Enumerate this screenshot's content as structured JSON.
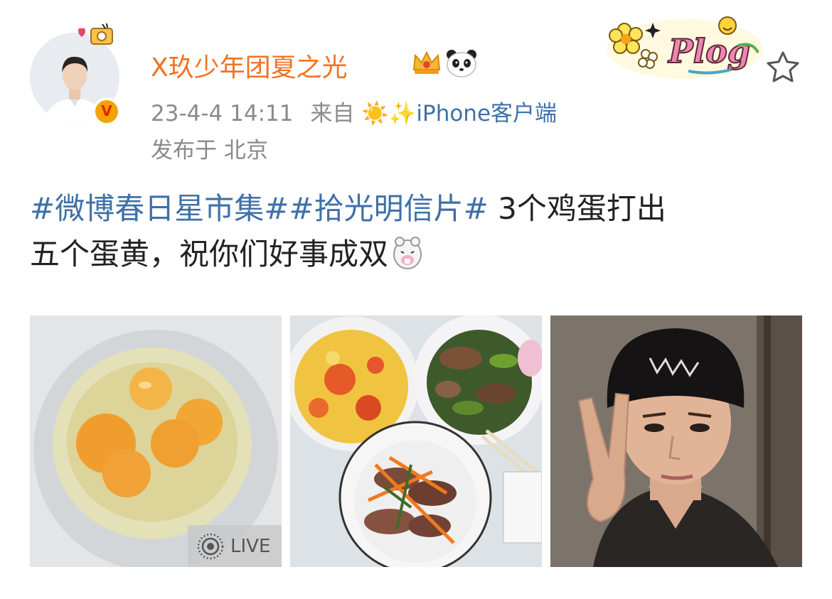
{
  "post": {
    "username": "X玖少年团夏之光",
    "verified_badge": "V",
    "timestamp": "23-4-4 14:11",
    "from_label": "来自",
    "source_emoji": "☀️✨",
    "source": "iPhone客户端",
    "location": "发布于 北京",
    "plog_label": "Plog",
    "content": {
      "tag1": "#微博春日星市集#",
      "tag2": "#拾光明信片#",
      "text_line1": " 3个鸡蛋打出",
      "text_line2": "五个蛋黄，祝你们好事成双"
    },
    "photos": [
      {
        "name": "eggs-photo",
        "live_label": "LIVE"
      },
      {
        "name": "dishes-photo"
      },
      {
        "name": "selfie-photo"
      }
    ],
    "icons": {
      "avatar": "avatar",
      "crown": "crown-icon",
      "panda": "panda-icon",
      "favorite": "star-outline-icon",
      "live": "live-photo-icon",
      "alpaca": "alpaca-emoji-icon"
    },
    "colors": {
      "username": "#f07323",
      "topic_link": "#3f70a8",
      "meta_text": "#8a8a8a",
      "body_text": "#222222"
    }
  }
}
